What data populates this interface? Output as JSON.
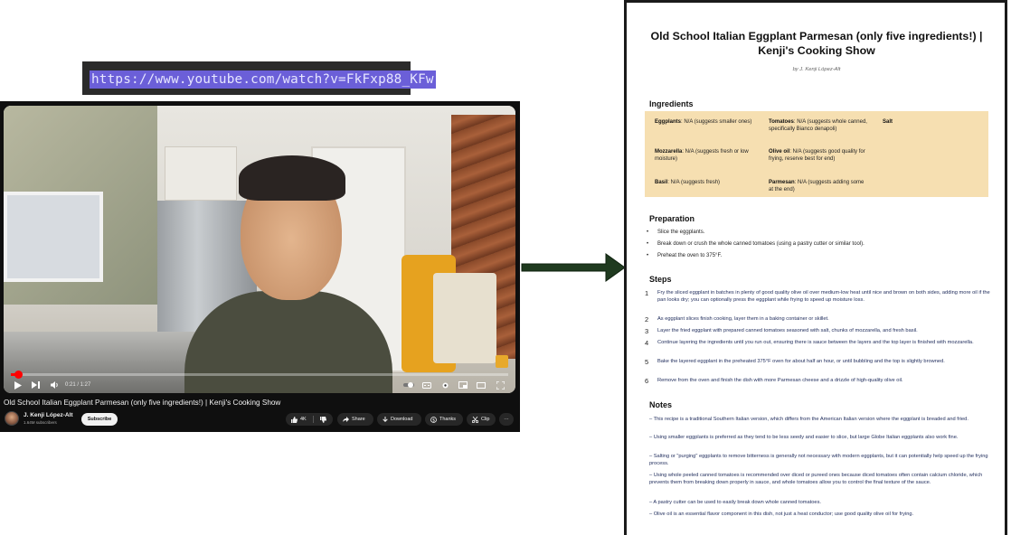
{
  "url_bar": {
    "url": "https://www.youtube.com/watch?v=FkFxp88_KFw"
  },
  "video": {
    "title": "Old School Italian Eggplant Parmesan (only five ingredients!) | Kenji's Cooking Show",
    "time": "0:21 / 1:27",
    "progress_fraction": 0.015,
    "channel": {
      "name": "J. Kenji López-Alt",
      "subscribers": "1.64M subscribers"
    },
    "subscribe_label": "Subscribe",
    "actions": {
      "likes": "4K",
      "share": "Share",
      "download": "Download",
      "thanks": "Thanks",
      "clip": "Clip",
      "more": "···"
    }
  },
  "colors": {
    "accent": "#6b5fd8",
    "progress": "#ff0000",
    "arrow": "#1f3a1f",
    "ingredients_bg": "#f6dfb1"
  },
  "document": {
    "title": "Old School Italian Eggplant Parmesan (only five ingredients!) | Kenji's Cooking Show",
    "byline": "by J. Kenji López-Alt",
    "ingredients_heading": "Ingredients",
    "ingredients": [
      {
        "name": "Eggplants",
        "detail": ": N/A (suggests smaller ones)"
      },
      {
        "name": "Tomatoes",
        "detail": ": N/A (suggests whole canned, specifically Bianco denapoli)"
      },
      {
        "name": "Salt",
        "detail": ""
      },
      {
        "name": "Mozzarella",
        "detail": ": N/A (suggests fresh or low moisture)"
      },
      {
        "name": "Olive oil",
        "detail": ": N/A (suggests good quality for frying, reserve best for end)"
      },
      {
        "name": "Basil",
        "detail": ": N/A (suggests fresh)"
      },
      {
        "name": "Parmesan",
        "detail": ": N/A (suggests adding some at the end)"
      }
    ],
    "preparation_heading": "Preparation",
    "preparation": [
      "Slice the eggplants.",
      "Break down or crush the whole canned tomatoes (using a pastry cutter or similar tool).",
      "Preheat the oven to 375°F."
    ],
    "steps_heading": "Steps",
    "steps": [
      {
        "num": "1",
        "text": "Fry the sliced eggplant in batches in plenty of good quality olive oil over medium-low heat until nice and brown on both sides, adding more oil if the pan looks dry; you can optionally press the eggplant while frying to speed up moisture loss."
      },
      {
        "num": "2",
        "text": "As eggplant slices finish cooking, layer them in a baking container or skillet."
      },
      {
        "num": "3",
        "text": "Layer the fried eggplant with prepared canned tomatoes seasoned with salt, chunks of mozzarella, and fresh basil."
      },
      {
        "num": "4",
        "text": "Continue layering the ingredients until you run out, ensuring there is sauce between the layers and the top layer is finished with mozzarella."
      },
      {
        "num": "5",
        "text": "Bake the layered eggplant in the preheated 375°F oven for about half an hour, or until bubbling and the top is slightly browned."
      },
      {
        "num": "6",
        "text": "Remove from the oven and finish the dish with more Parmesan cheese and a drizzle of high-quality olive oil."
      }
    ],
    "notes_heading": "Notes",
    "notes": [
      "– This recipe is a traditional Southern Italian version, which differs from the American Italian version where the eggplant is breaded and fried.",
      "– Using smaller eggplants is preferred as they tend to be less seedy and easier to slice, but large Globe Italian eggplants also work fine.",
      "– Salting or \"purging\" eggplants to remove bitterness is generally not necessary with modern eggplants, but it can potentially help speed up the frying process.",
      "– Using whole peeled canned tomatoes is recommended over diced or pureed ones because diced tomatoes often contain calcium chloride, which prevents them from breaking down properly in sauce, and whole tomatoes allow you to control the final texture of the sauce.",
      "– A pastry cutter can be used to easily break down whole canned tomatoes.",
      "– Olive oil is an essential flavor component in this dish, not just a heat conductor; use good quality olive oil for frying."
    ]
  }
}
